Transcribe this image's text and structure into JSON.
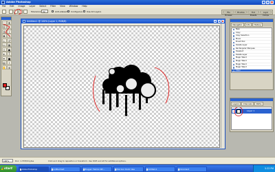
{
  "app": {
    "title": "Adobe Photoshop",
    "menu": [
      "File",
      "Edit",
      "Image",
      "Layer",
      "Select",
      "Filter",
      "View",
      "Window",
      "Help"
    ]
  },
  "options_bar": {
    "tolerance_label": "Tolerance:",
    "tolerance_value": "32",
    "antialiased_label": "Anti-aliased",
    "antialiased_checked": true,
    "contiguous_label": "Contiguous",
    "contiguous_checked": true,
    "use_all_layers_label": "Use All Layers",
    "use_all_layers_checked": false,
    "dock_tabs": [
      "File Browser",
      "Brushes",
      "Tool Presets",
      "Layer Comps"
    ]
  },
  "document": {
    "title": "Untitled-1 @ 100% (Layer 1, RGB/8)"
  },
  "status_bar": {
    "zoom": "100%",
    "doc_size": "Doc: 1.37M/0 bytes",
    "message": "Click and drag to reposition or transform. Use Shift and Alt for additional options."
  },
  "history_panel": {
    "tabs": [
      "Navigator",
      "Info",
      "History"
    ],
    "items": [
      "New",
      "Copy",
      "Copy Selection",
      "Move",
      "Brush Tool",
      "Delete Layer",
      "Rectangular Marquee",
      "Deselect",
      "Delete Layer",
      "Magic Wand",
      "Magic Wand",
      "Magic Wand",
      "Magic Wand",
      "Clear"
    ],
    "selected_index": 13
  },
  "layers_panel": {
    "tabs": [
      "Layers",
      "Channels",
      "Paths"
    ],
    "layer_name": "Layer 1"
  },
  "taskbar": {
    "start_label": "start",
    "tasks": [
      "Adobe Photoshop",
      "untitled text",
      "Blogger: Fashion Wh...",
      "Mod box: Darkr idea",
      "Untitled-1",
      "Document"
    ],
    "clock": "5:33 PM"
  },
  "colors": {
    "accent": "#2a62d0",
    "foreground_swatch": "#e02020",
    "background_swatch": "#ffffff",
    "annotation_red": "#e01010"
  }
}
